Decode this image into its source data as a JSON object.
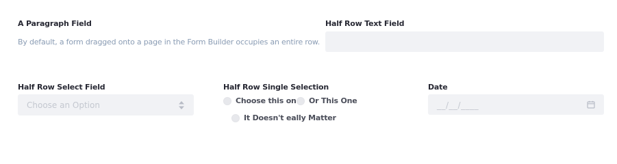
{
  "paragraph_field": {
    "label": "A Paragraph Field",
    "text": "By default, a form dragged onto a page in the Form Builder occupies an entire row."
  },
  "half_row_text_field": {
    "label": "Half Row Text Field",
    "value": ""
  },
  "half_row_select_field": {
    "label": "Half Row Select Field",
    "placeholder": "Choose an Option",
    "icon": "select-arrows-icon"
  },
  "half_row_single_selection": {
    "label": "Half Row Single Selection",
    "options": [
      {
        "label": "Choose this one",
        "selected": false
      },
      {
        "label": "Or This One",
        "selected": false
      },
      {
        "label": "It Doesn't eally Matter",
        "selected": false
      }
    ]
  },
  "date_field": {
    "label": "Date",
    "placeholder": "__/__/____",
    "icon": "calendar-icon"
  },
  "colors": {
    "label": "#272833",
    "paragraph_text": "#8a9cb4",
    "input_background": "#f1f2f5",
    "placeholder": "#c4c8d0",
    "radio_fill": "#e7e8ec"
  }
}
